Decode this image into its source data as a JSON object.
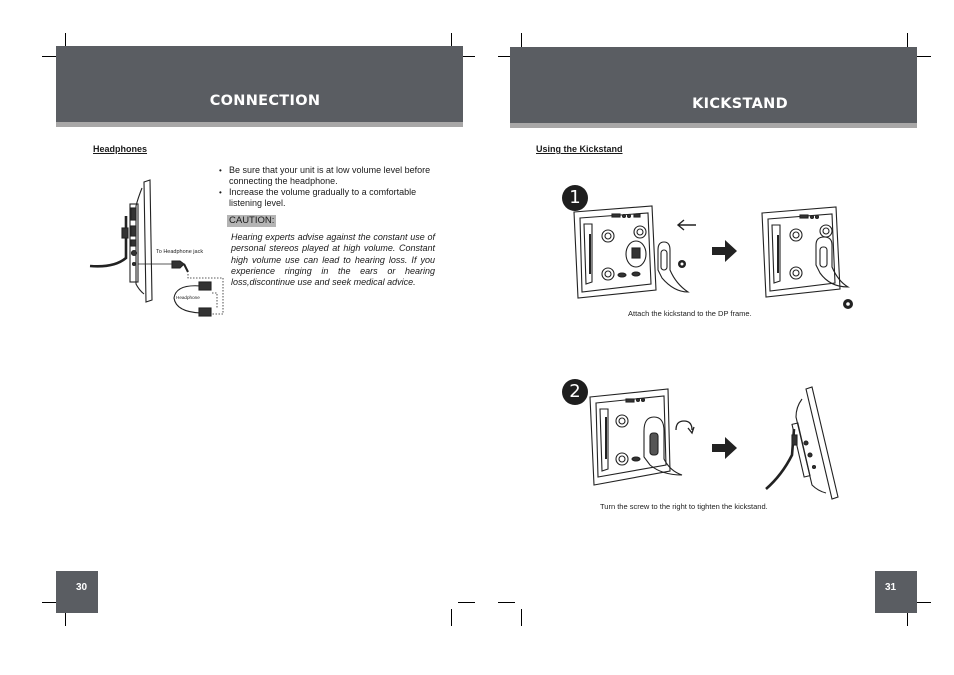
{
  "left_page": {
    "header_title": "CONNECTION",
    "subheading": "Headphones",
    "bullets": [
      "Be sure that your unit is at low volume level before connecting the headphone.",
      "Increase the volume gradually to a comfortable listening level."
    ],
    "caution_label": "CAUTION:",
    "caution_text": "Hearing experts advise against the constant use of personal stereos played at high volume. Constant high volume use can lead to hearing loss. If you experience ringing in the ears or hearing loss,discontinue use and seek medical advice.",
    "diagram_labels": {
      "jack": "To Headphone jack",
      "headphone": "Headphone"
    },
    "page_number": "30"
  },
  "right_page": {
    "header_title": "KICKSTAND",
    "subheading": "Using the Kickstand",
    "steps": [
      {
        "number": "1",
        "caption": "Attach the kickstand to the DP frame."
      },
      {
        "number": "2",
        "caption": "Turn the screw to the right to tighten the kickstand."
      }
    ],
    "page_number": "31"
  },
  "colors": {
    "header_bg": "#5a5d62",
    "header_stripe": "#a8a7a7",
    "caution_bg": "#b4b4b4"
  }
}
